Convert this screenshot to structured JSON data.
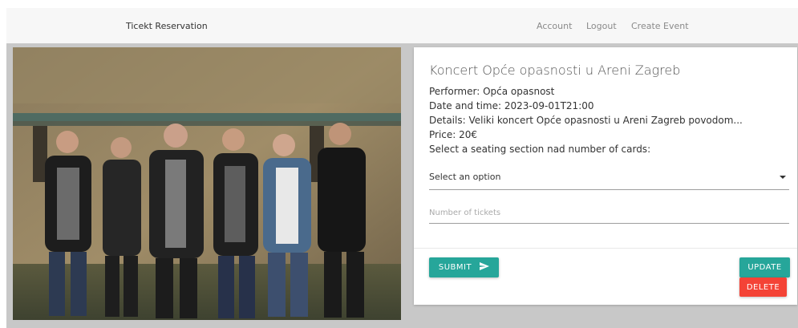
{
  "navbar": {
    "brand": "Ticekt Reservation",
    "links": [
      "Account",
      "Logout",
      "Create Event"
    ]
  },
  "event": {
    "title": "Koncert Opće opasnosti u Areni Zagreb",
    "performer": "Performer: Opća opasnost",
    "datetime": "Date and time: 2023-09-01T21:00",
    "details": "Details: Veliki koncert Opće opasnosti u Areni Zagreb povodom...",
    "price": "Price: 20€",
    "instruction": "Select a seating section nad number of cards:"
  },
  "form": {
    "select_value": "Select an option",
    "tickets_placeholder": "Number of tickets"
  },
  "buttons": {
    "submit": "SUBMIT",
    "update": "UPDATE",
    "delete": "DELETE"
  },
  "colors": {
    "teal": "#26a69a",
    "red": "#f44336"
  },
  "icons": {
    "submit": "send-icon",
    "select": "caret-down-icon"
  }
}
